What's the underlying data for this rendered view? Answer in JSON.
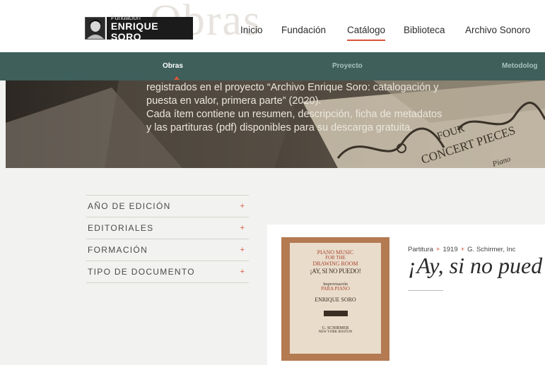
{
  "header": {
    "ghost_title": "Obras",
    "logo": {
      "small": "Fundación",
      "big": "ENRIQUE SORO"
    },
    "nav": [
      {
        "label": "Inicio"
      },
      {
        "label": "Fundación"
      },
      {
        "label": "Catálogo",
        "active": true
      },
      {
        "label": "Biblioteca"
      },
      {
        "label": "Archivo Sonoro"
      }
    ]
  },
  "subnav": {
    "items": [
      {
        "label": "Obras",
        "active": true
      },
      {
        "label": "Proyecto"
      },
      {
        "label": "Metodolog"
      }
    ]
  },
  "hero": {
    "lines": [
      "registrados en el proyecto “Archivo Enrique Soro: catalogación y",
      "puesta en valor, primera parte” (2020).",
      "Cada ítem contiene un resumen, descripción, ficha de metadatos",
      "y las partituras (pdf) disponibles para su descarga gratuita."
    ],
    "background_score": {
      "line1": "FOUR",
      "line2": "CONCERT PIECES",
      "line3": "Piano"
    }
  },
  "filters": [
    {
      "label": "AÑO DE EDICIÓN",
      "icon": "+"
    },
    {
      "label": "EDITORIALES",
      "icon": "+"
    },
    {
      "label": "FORMACIÓN",
      "icon": "+"
    },
    {
      "label": "TIPO DE DOCUMENTO",
      "icon": "+"
    }
  ],
  "result": {
    "meta": {
      "type": "Partitura",
      "year": "1919",
      "publisher": "G. Schirmer, Inc",
      "separator": "+"
    },
    "title": "¡Ay, si no pued",
    "cover": {
      "l1": "PIANO MUSIC",
      "l2": "FOR THE",
      "l3": "DRAWING ROOM",
      "l4": "¡AY, SI NO PUEDO!",
      "l5": "Improvisación",
      "l6": "PARA PIANO",
      "l7": "ENRIQUE SORO",
      "l8": "G. SCHIRMER",
      "l9": "NEW YORK   BOSTON"
    }
  },
  "colors": {
    "accent": "#d9553a",
    "subnav_bg": "#3e5f5a",
    "page_bg": "#f2f2f0"
  }
}
